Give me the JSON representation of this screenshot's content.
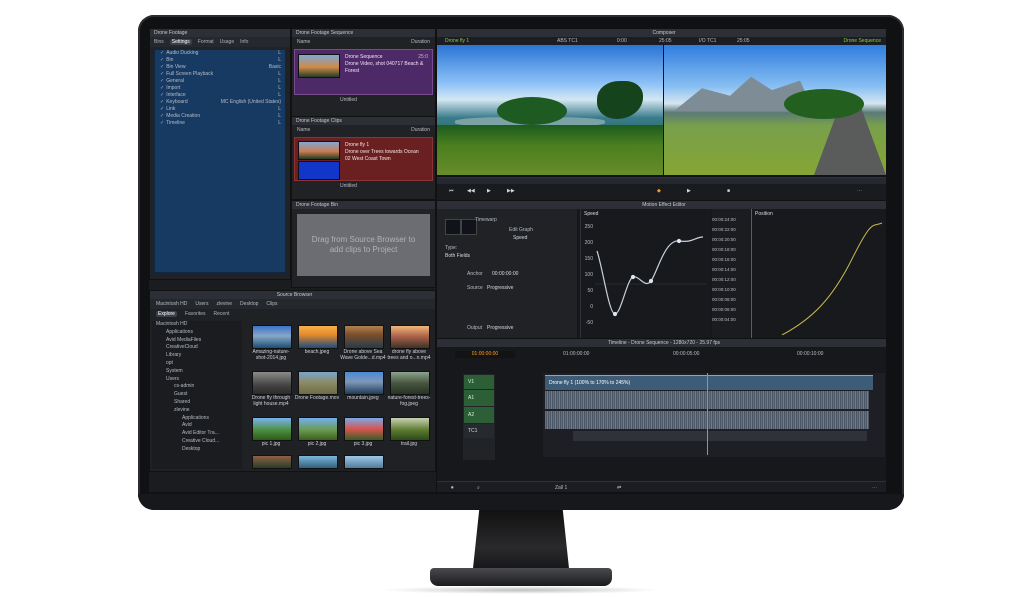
{
  "window": {
    "composer_title": "Composer",
    "left_bin_title": "Drone Footage",
    "bin_tabs": [
      "Bins",
      "Settings",
      "Format",
      "Usage",
      "Info"
    ],
    "settings_items": [
      "Audio Ducking",
      "Bin",
      "Bin View",
      "Full Screen Playback",
      "General",
      "Import",
      "Interface",
      "Keyboard",
      "Link",
      "Media Creation",
      "Timeline"
    ],
    "settings_values": {
      "bin_view": "Basic",
      "keyboard": "MC English (United States)"
    },
    "sequence_title": "Drone Footage Sequence",
    "name_label": "Name",
    "duration_label": "Duration",
    "seq_item": {
      "title": "Drone Sequence",
      "desc": "Drone Video, shot 040717 Beach & Forest",
      "code": "25:0"
    },
    "clips_title": "Drone Footage Clips",
    "clips_item": {
      "title": "Drone fly 1",
      "desc": "Drone over Trees towards Ocean",
      "code2": "02 West Coast Town"
    },
    "untitled": "Untitled",
    "footage_bin_title": "Drone Footage Bin",
    "drop_text": "Drag from Source Browser to add clips to Project"
  },
  "composer": {
    "clip_name": "Drone fly 1",
    "abs_tc": "ABS TC1",
    "tc_left": "0:00",
    "tc_right": "25:05",
    "io_tc": "I/O TC1",
    "tc_right2": "25:05",
    "seq_label": "Drone Sequence"
  },
  "motion_effect": {
    "title": "Motion Effect Editor",
    "header_speed": "Speed",
    "header_position": "Position",
    "timewarp": "Timewarp",
    "edit_graph": "Edit Graph",
    "speed_field": "Speed",
    "type_label": "Type:",
    "type_value": "Both Fields",
    "anchor_label": "Anchor",
    "anchor_value": "00:00:00:00",
    "source_label": "Source",
    "source_value": "Progressive",
    "output_label": "Output",
    "output_value": "Progressive",
    "y_ticks": [
      "250",
      "200",
      "150",
      "100",
      "50",
      "0",
      "-50"
    ],
    "tc_ticks": [
      "00:00:24:00",
      "00:00:22:00",
      "00:00:20:00",
      "00:00:18:00",
      "00:00:16:00",
      "00:00:14:00",
      "00:00:12:00",
      "00:00:10:00",
      "00:00:08:00",
      "00:00:06:00",
      "00:00:04:00"
    ]
  },
  "source_browser": {
    "title": "Source Browser",
    "breadcrumb": [
      "Macintosh HD",
      "Users",
      "zlevine",
      "Desktop",
      "Clips"
    ],
    "tabs": [
      "Explore",
      "Favorites",
      "Recent"
    ],
    "tree": [
      "Macintosh HD",
      "Applications",
      "Avid MediaFiles",
      "CreativeCloud",
      "Library",
      "opt",
      "System",
      "Users",
      "cs-admin",
      "Guest",
      "Shared",
      "zlevine",
      "Applications",
      "Avid",
      "Avid Editor Tra...",
      "Creative Cloud...",
      "Desktop"
    ],
    "files": [
      {
        "name": "Amazing-nature-shot-2014.jpg"
      },
      {
        "name": "beach.jpeg"
      },
      {
        "name": "Drone above Sea Wave Golde...d.mp4"
      },
      {
        "name": "drone fly above trees and o...n.mp4"
      },
      {
        "name": "Drone fly through light house.mp4"
      },
      {
        "name": "Drone Footage.mov"
      },
      {
        "name": "mountain.jpeg"
      },
      {
        "name": "nature-forest-trees-fog.jpeg"
      },
      {
        "name": "pic 1.jpg"
      },
      {
        "name": "pic 2.jpg"
      },
      {
        "name": "pic 3.jpg"
      },
      {
        "name": "trail.jpg"
      }
    ]
  },
  "timeline": {
    "title": "Timeline - Drone Sequence - 1280x720 - 25.97 fps",
    "tc_display": "01:00:00:00",
    "time_marks": [
      "01:00:00:00",
      "00:00:05:00",
      "00:00:10:00"
    ],
    "tracks": [
      "V1",
      "A1",
      "A2",
      "TC1"
    ],
    "clip_name": "Drone fly 1 (100% to 170% to 245%)",
    "footer_zoom": "Zall 1"
  },
  "colors": {
    "accent_green": "#87d13d",
    "accent_orange": "#ff9e21",
    "seq_purple": "#4d2a67",
    "clip_red": "#6a2020",
    "track_green": "#2d5f36"
  }
}
